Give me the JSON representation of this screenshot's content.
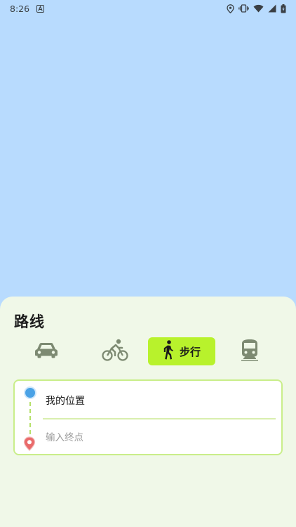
{
  "status_bar": {
    "time": "8:26",
    "icons": [
      "notification-a-icon",
      "location-icon",
      "vibrate-icon",
      "wifi-icon",
      "signal-icon",
      "battery-icon"
    ]
  },
  "sheet": {
    "title": "路线",
    "modes": [
      {
        "name": "car",
        "icon": "car-icon",
        "selected": false
      },
      {
        "name": "bike",
        "icon": "bicycle-icon",
        "selected": false
      },
      {
        "name": "walk",
        "icon": "walk-icon",
        "label": "步行",
        "selected": true
      },
      {
        "name": "transit",
        "icon": "train-icon",
        "selected": false
      }
    ]
  },
  "route": {
    "start": "我的位置",
    "destination_value": "",
    "destination_placeholder": "输入终点"
  },
  "colors": {
    "map_background": "#b8dbfe",
    "sheet_background": "#f0f8e8",
    "accent": "#b8f22c",
    "card_border": "#c9ee8a",
    "start_dot": "#4aa2e6",
    "end_pin": "#e96a6a",
    "mode_icon": "#7d8a72"
  }
}
